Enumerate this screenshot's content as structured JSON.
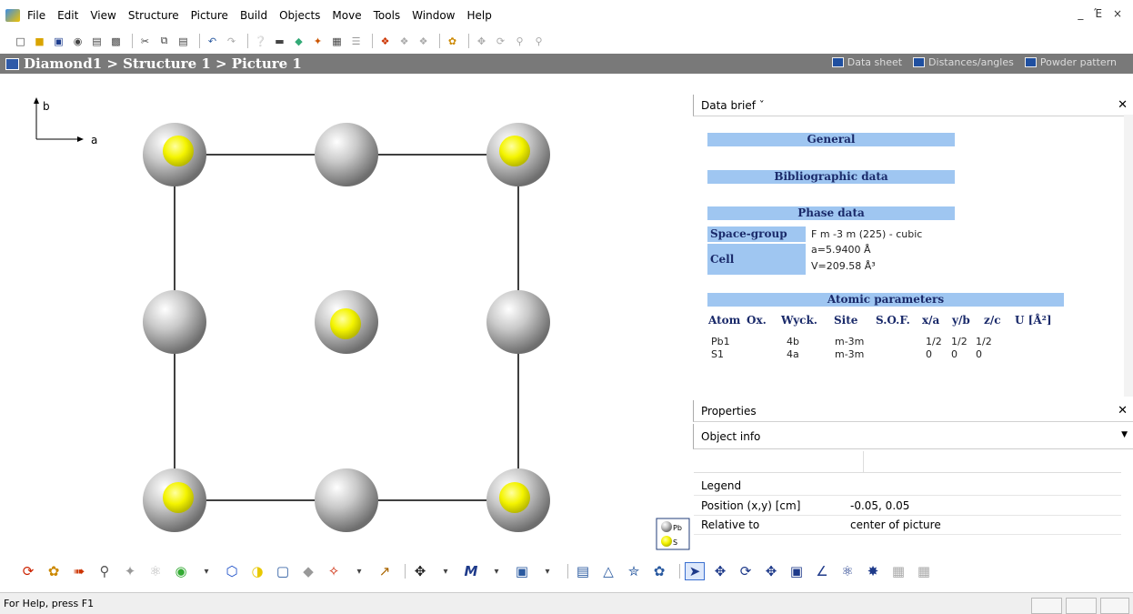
{
  "menu": [
    "File",
    "Edit",
    "View",
    "Structure",
    "Picture",
    "Build",
    "Objects",
    "Move",
    "Tools",
    "Window",
    "Help"
  ],
  "window_controls": "_ Έ ×",
  "title": {
    "breadcrumb": "Diamond1 > Structure 1 > Picture 1",
    "links": [
      "Data sheet",
      "Distances/angles",
      "Powder pattern"
    ]
  },
  "viewer": {
    "axis_b": "b",
    "axis_a": "a",
    "legend_pb": "Pb",
    "legend_s": "S"
  },
  "data_brief": {
    "header": "Data brief  ˇ",
    "general": "General",
    "bibliographic": "Bibliographic data",
    "phase": "Phase data",
    "space_group_label": "Space-group",
    "space_group_value": "F m -3 m (225) - cubic",
    "cell_label": "Cell",
    "cell_a": "a=5.9400 Å",
    "cell_v": "V=209.58 Å³",
    "atomic_parameters": "Atomic parameters",
    "atom_columns": [
      "Atom",
      "Ox.",
      "Wyck.",
      "Site",
      "S.O.F.",
      "x/a",
      "y/b",
      "z/c",
      "U [Å²]"
    ],
    "atoms": [
      {
        "atom": "Pb1",
        "ox": "",
        "wyck": "4b",
        "site": "m-3m",
        "sof": "",
        "x": "1/2",
        "y": "1/2",
        "z": "1/2"
      },
      {
        "atom": "S1",
        "ox": "",
        "wyck": "4a",
        "site": "m-3m",
        "sof": "",
        "x": "0",
        "y": "0",
        "z": "0"
      }
    ]
  },
  "properties": {
    "header": "Properties",
    "dropdown": "Object info",
    "rows": [
      {
        "key": "Legend",
        "value": ""
      },
      {
        "key": "Position (x,y) [cm]",
        "value": "-0.05, 0.05"
      },
      {
        "key": "Relative to",
        "value": "center of picture"
      }
    ]
  },
  "status": "For Help, press F1",
  "colors": {
    "sphere": "#bdbdbd",
    "sulfur": "#f4f400",
    "section": "#9fc6f1",
    "titlebar": "#797979"
  }
}
